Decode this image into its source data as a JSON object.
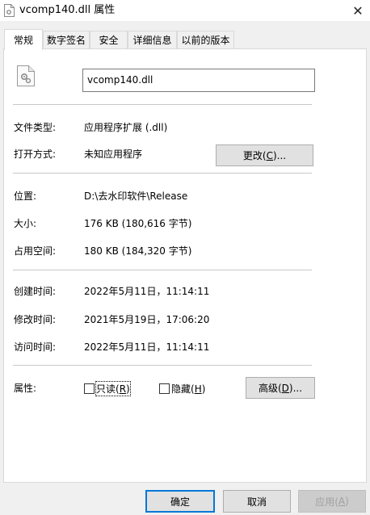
{
  "window": {
    "title": "vcomp140.dll 属性",
    "close_glyph": "✕"
  },
  "tabs": [
    {
      "label": "常规",
      "active": true
    },
    {
      "label": "数字签名",
      "active": false
    },
    {
      "label": "安全",
      "active": false
    },
    {
      "label": "详细信息",
      "active": false
    },
    {
      "label": "以前的版本",
      "active": false
    }
  ],
  "general": {
    "file_name": "vcomp140.dll",
    "file_type_label": "文件类型:",
    "file_type_value": "应用程序扩展 (.dll)",
    "opens_with_label": "打开方式:",
    "opens_with_value": "未知应用程序",
    "change_button": {
      "text": "更改(",
      "mnemonic": "C",
      "suffix": ")..."
    },
    "location_label": "位置:",
    "location_value": "D:\\去水印软件\\Release",
    "size_label": "大小:",
    "size_value": "176 KB (180,616 字节)",
    "size_on_disk_label": "占用空间:",
    "size_on_disk_value": "180 KB (184,320 字节)",
    "created_label": "创建时间:",
    "created_value": "2022年5月11日，11:14:11",
    "modified_label": "修改时间:",
    "modified_value": "2021年5月19日，17:06:20",
    "accessed_label": "访问时间:",
    "accessed_value": "2022年5月11日，11:14:11",
    "attributes_label": "属性:",
    "readonly": {
      "text": "只读(",
      "mnemonic": "R",
      "suffix": ")",
      "checked": false
    },
    "hidden": {
      "text": "隐藏(",
      "mnemonic": "H",
      "suffix": ")",
      "checked": false
    },
    "advanced_button": {
      "text": "高级(",
      "mnemonic": "D",
      "suffix": ")..."
    }
  },
  "footer": {
    "ok": "确定",
    "cancel": "取消",
    "apply": {
      "text": "应用(",
      "mnemonic": "A",
      "suffix": ")"
    }
  },
  "colors": {
    "accent": "#0078d7",
    "panel_bg": "#ffffff",
    "window_bg": "#f0f0f0"
  },
  "icons": {
    "title": "dll-file-icon",
    "file": "dll-file-gear-icon"
  }
}
